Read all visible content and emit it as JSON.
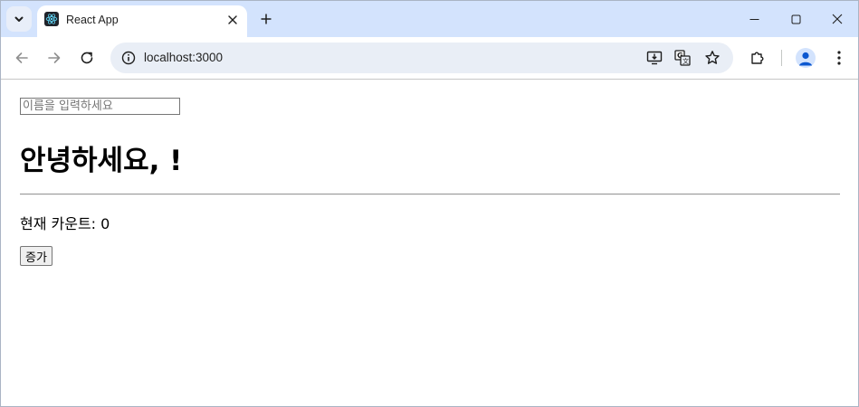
{
  "browser": {
    "tab": {
      "title": "React App",
      "favicon": "react-logo-icon"
    },
    "address_bar": {
      "url": "localhost:3000"
    },
    "icons": {
      "tab_search": "chevron-down-icon",
      "close_tab": "close-icon",
      "new_tab": "plus-icon",
      "minimize": "minimize-icon",
      "maximize": "maximize-icon",
      "close_window": "close-icon",
      "back": "back-arrow-icon",
      "forward": "forward-arrow-icon",
      "reload": "reload-icon",
      "site_info": "info-icon",
      "install_app": "install-app-icon",
      "translate": "translate-icon",
      "bookmark": "star-icon",
      "extensions": "puzzle-icon",
      "profile": "avatar-icon",
      "menu": "kebab-menu-icon"
    },
    "colors": {
      "tabstrip": "#d3e3fd",
      "omnibox": "#e9eef6",
      "accent": "#0b57d0"
    }
  },
  "page": {
    "name_input": {
      "value": "",
      "placeholder": "이름을 입력하세요"
    },
    "greeting": "안녕하세요, !",
    "count_text": "현재 카운트: 0",
    "increment_label": "증가"
  }
}
